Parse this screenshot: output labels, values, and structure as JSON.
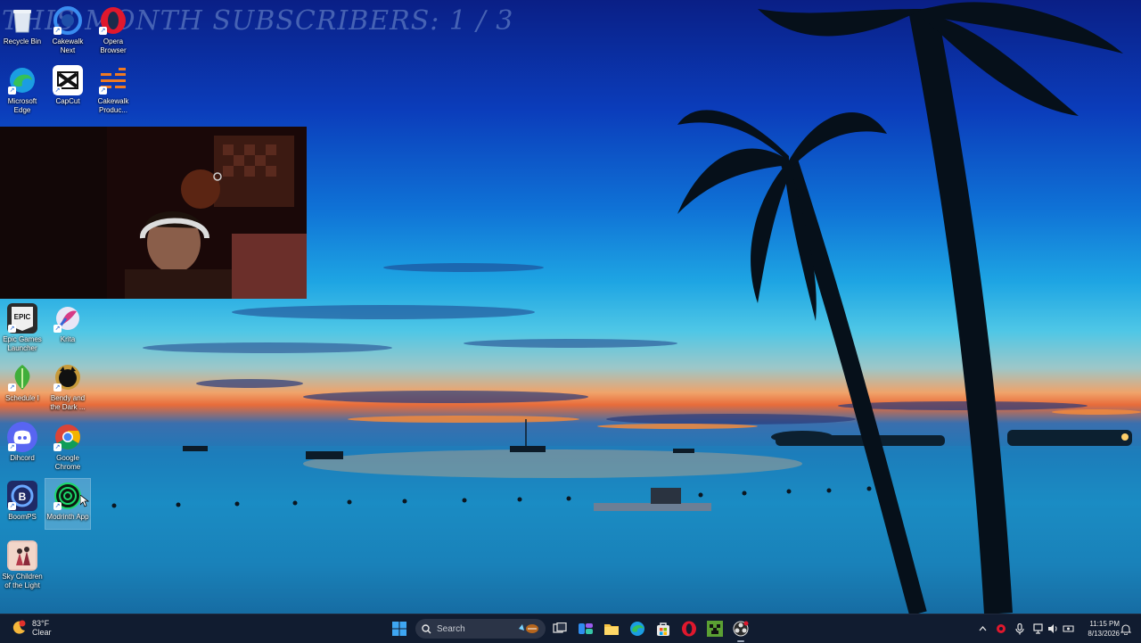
{
  "overlay": {
    "title": "THIS MONTH SUBSCRIBERS: 1 / 3"
  },
  "desktop_icons": [
    {
      "label": "Recycle Bin",
      "icon": "recycle-bin-icon"
    },
    {
      "label": "Cakewalk Next",
      "icon": "cakewalk-next-icon"
    },
    {
      "label": "Opera Browser",
      "icon": "opera-icon"
    },
    {
      "label": "Microsoft Edge",
      "icon": "edge-icon"
    },
    {
      "label": "CapCut",
      "icon": "capcut-icon"
    },
    {
      "label": "Cakewalk Produc...",
      "icon": "cakewalk-product-icon"
    },
    {
      "label": "Epic Games Launcher",
      "icon": "epic-games-icon"
    },
    {
      "label": "Krita",
      "icon": "krita-icon"
    },
    {
      "label": "Schedule I",
      "icon": "schedule-one-icon"
    },
    {
      "label": "Bendy and the Dark ...",
      "icon": "bendy-icon"
    },
    {
      "label": "Dihcord",
      "icon": "discord-icon"
    },
    {
      "label": "Google Chrome",
      "icon": "chrome-icon"
    },
    {
      "label": "BoomPS",
      "icon": "boomps-icon"
    },
    {
      "label": "Modrinth App",
      "icon": "modrinth-icon"
    },
    {
      "label": "Sky Children of the Light",
      "icon": "sky-icon"
    }
  ],
  "webcam": {
    "icon": "webcam-feed"
  },
  "taskbar": {
    "weather": {
      "temp": "83°F",
      "condition": "Clear",
      "icon": "weather-moon-icon"
    },
    "search": {
      "placeholder": "Search"
    },
    "apps": [
      "windows-start-icon",
      "task-view-icon",
      "widgets-icon",
      "file-explorer-icon",
      "edge-icon",
      "store-icon",
      "opera-icon",
      "minecraft-icon",
      "obs-icon"
    ],
    "clock": {
      "time": "11:15 PM",
      "date": "8/13/2026"
    }
  },
  "colors": {
    "taskbar_bg": "#121c30",
    "accent": "#0078d4"
  }
}
